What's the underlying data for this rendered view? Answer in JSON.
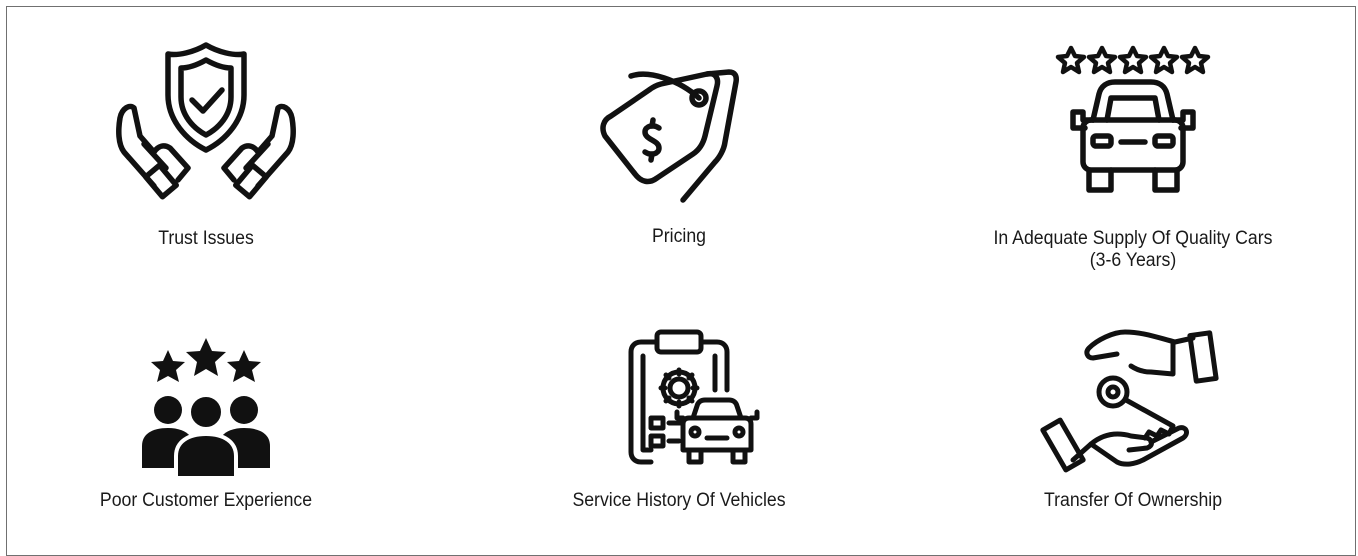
{
  "items": [
    {
      "label": "Trust Issues",
      "icon": "shield-hands-icon"
    },
    {
      "label": "Pricing",
      "icon": "price-tag-icon"
    },
    {
      "label": "In Adequate Supply Of Quality Cars (3-6 Years)",
      "icon": "car-rating-icon"
    },
    {
      "label": "Poor Customer Experience",
      "icon": "customer-rating-icon"
    },
    {
      "label": "Service History Of Vehicles",
      "icon": "service-history-icon"
    },
    {
      "label": "Transfer Of Ownership",
      "icon": "key-handover-icon"
    }
  ],
  "colors": {
    "icon": "#111111",
    "text": "#1a1a1a",
    "border": "#707070",
    "background": "#ffffff"
  }
}
